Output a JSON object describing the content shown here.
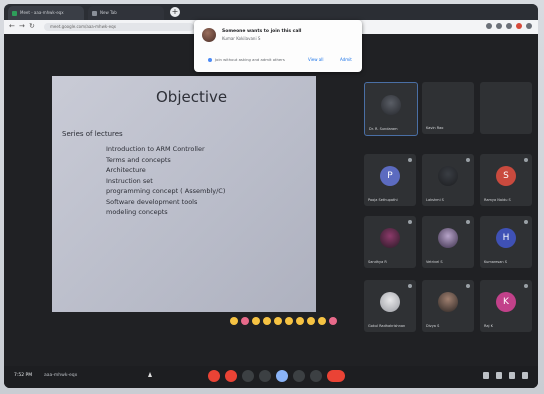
{
  "tabs": [
    {
      "label": "Meet - aaa-mhwk-eqx",
      "favicon_color": "#2e9e5a"
    },
    {
      "label": "New Tab",
      "favicon_color": "#8a8f98"
    }
  ],
  "url": "meet.google.com/aaa-mhwk-eqx",
  "popup": {
    "title": "Someone wants to join this call",
    "subtitle": "Kumar Kokilavani S",
    "note": "Join without asking and admit others",
    "buttons": [
      "View all",
      "Admit"
    ]
  },
  "slide": {
    "title": "Objective",
    "lead": "Series of lectures",
    "items": [
      "Introduction to ARM Controller",
      "Terms and concepts",
      "Architecture",
      "Instruction set",
      "programming concept ( Assembly/C)",
      "Software development tools",
      "modeling concepts"
    ]
  },
  "participants": [
    {
      "name": "Dr. R. Sundaram",
      "initial": "",
      "color": "#2f3134"
    },
    {
      "name": "Kavin Rao",
      "initial": "",
      "color": "#2f3134"
    },
    {
      "name": "Pooja Sethupathi",
      "initial": "P",
      "color": "#5c6bc0"
    },
    {
      "name": "Lakshmi S",
      "initial": "",
      "color": "#2f3134"
    },
    {
      "name": "Ramya Naidu S",
      "initial": "S",
      "color": "#c94a3e"
    },
    {
      "name": "Sandhya R",
      "initial": "",
      "color": "#2f3134"
    },
    {
      "name": "Vetrivel S",
      "initial": "",
      "color": "#2f3134"
    },
    {
      "name": "Kumaresan S",
      "initial": "H",
      "color": "#3f51b5"
    },
    {
      "name": "Gokul Radhakrishnan",
      "initial": "",
      "color": "#2f3134"
    },
    {
      "name": "Divya S",
      "initial": "",
      "color": "#2f3134"
    },
    {
      "name": "Raj K",
      "initial": "K",
      "color": "#c2418a"
    }
  ],
  "bottom": {
    "time": "7:52 PM",
    "code": "aaa-mhwk-eqx"
  }
}
